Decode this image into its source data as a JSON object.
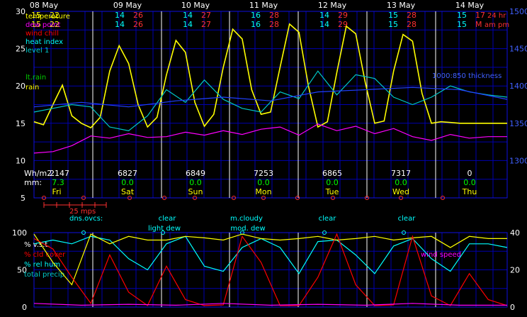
{
  "chart_data": [
    {
      "type": "line",
      "panel": "upper",
      "x_unit": "date",
      "x_ticks": [
        "08 May",
        "09 May",
        "10 May",
        "11 May",
        "12 May",
        "13 May",
        "14 May"
      ],
      "day_labels": [
        "Fri",
        "Sat",
        "Sun",
        "Mon",
        "Tue",
        "Wed",
        "Thu"
      ],
      "ylim_left": [
        5,
        30
      ],
      "yticks_left": [
        "5",
        "10",
        "15",
        "20",
        "25",
        "30"
      ],
      "ylim_right": [
        1250,
        1500
      ],
      "yticks_right": [
        "1300",
        "1350",
        "1400",
        "1450",
        "1500"
      ],
      "legend_left": [
        {
          "label": "temperature",
          "color": "#ffff00"
        },
        {
          "label": "dew point",
          "color": "#ff00ff"
        },
        {
          "label": "wind chill",
          "color": "#ff0000"
        },
        {
          "label": "heat index",
          "color": "#00ffff"
        },
        {
          "label": "level 1",
          "color": "#00c8c8"
        }
      ],
      "legend_rain": [
        {
          "label": "lt.rain",
          "color": "#00cc00"
        },
        {
          "label": "rain",
          "color": "#ffff00"
        }
      ],
      "thickness_label": "1000:850 thickness",
      "hi_lo_rows": [
        {
          "day": "08 May",
          "a_left": "15",
          "a_right": "22",
          "b_left": "15",
          "b_right": "22",
          "color": "#ffff00"
        },
        {
          "day": "09 May",
          "a_left": "14",
          "a_right": "26",
          "b_left": "14",
          "b_right": "26"
        },
        {
          "day": "10 May",
          "a_left": "14",
          "a_right": "27",
          "b_left": "14",
          "b_right": "27"
        },
        {
          "day": "11 May",
          "a_left": "16",
          "a_right": "28",
          "b_left": "16",
          "b_right": "28"
        },
        {
          "day": "12 May",
          "a_left": "14",
          "a_right": "29",
          "b_left": "14",
          "b_right": "29"
        },
        {
          "day": "13 May",
          "a_left": "15",
          "a_right": "28",
          "b_left": "15",
          "b_right": "28"
        },
        {
          "day": "14 May",
          "a_left": "15",
          "a_right": "17",
          "b_left": "15",
          "b_right": "M"
        }
      ],
      "hi_lo_suffix": {
        "top": "24 hr",
        "bottom": "am pm"
      },
      "radiation": {
        "label": "Wh/m2:",
        "values": [
          "2147",
          "6827",
          "6849",
          "7253",
          "6865",
          "7317",
          "0"
        ]
      },
      "precip": {
        "label": "mm:",
        "values": [
          "7.3",
          "0.0",
          "0.0",
          "0.0",
          "0.0",
          "0.0",
          "0.0"
        ]
      },
      "wind_scale_label": "25 mps",
      "series": [
        {
          "name": "temperature",
          "color": "#ffff00",
          "x": [
            0,
            0.02,
            0.04,
            0.06,
            0.08,
            0.1,
            0.12,
            0.14,
            0.16,
            0.18,
            0.2,
            0.22,
            0.24,
            0.26,
            0.28,
            0.3,
            0.32,
            0.34,
            0.36,
            0.38,
            0.4,
            0.42,
            0.44,
            0.46,
            0.48,
            0.5,
            0.52,
            0.54,
            0.56,
            0.58,
            0.6,
            0.62,
            0.64,
            0.66,
            0.68,
            0.7,
            0.72,
            0.74,
            0.76,
            0.78,
            0.8,
            0.82,
            0.84,
            0.86,
            0.88,
            0.9,
            0.92,
            0.94,
            0.96,
            0.98,
            1.0
          ],
          "y": [
            15.2,
            14.8,
            17.5,
            20.1,
            16.0,
            15.0,
            14.4,
            15.8,
            22.0,
            25.4,
            23.0,
            17.5,
            14.5,
            15.8,
            21.5,
            26.1,
            24.5,
            17.8,
            14.6,
            16.2,
            22.5,
            27.6,
            26.3,
            19.5,
            16.2,
            16.5,
            22.5,
            28.3,
            27.2,
            20.0,
            14.5,
            15.2,
            21.8,
            28.0,
            27.0,
            20.5,
            15.0,
            15.3,
            22.0,
            26.9,
            26.0,
            19.0,
            15.0,
            15.2,
            15.1,
            15.0,
            15.0,
            15.0,
            15.0,
            15.0,
            15.0
          ]
        },
        {
          "name": "dew point",
          "color": "#ff00ff",
          "x": [
            0,
            0.04,
            0.08,
            0.12,
            0.16,
            0.2,
            0.24,
            0.28,
            0.32,
            0.36,
            0.4,
            0.44,
            0.48,
            0.52,
            0.56,
            0.6,
            0.64,
            0.68,
            0.72,
            0.76,
            0.8,
            0.84,
            0.88,
            0.92,
            0.96,
            1.0
          ],
          "y": [
            11.0,
            11.2,
            12.0,
            13.3,
            13.0,
            13.6,
            13.1,
            13.2,
            13.8,
            13.4,
            14.0,
            13.5,
            14.2,
            14.5,
            13.4,
            14.9,
            14.0,
            14.6,
            13.6,
            14.3,
            13.2,
            12.7,
            13.5,
            13.0,
            13.2,
            13.2
          ]
        },
        {
          "name": "level 1",
          "color": "#00c8c8",
          "axis": "right",
          "x": [
            0,
            0.04,
            0.08,
            0.12,
            0.16,
            0.2,
            0.24,
            0.28,
            0.32,
            0.36,
            0.4,
            0.44,
            0.48,
            0.52,
            0.56,
            0.6,
            0.64,
            0.68,
            0.72,
            0.76,
            0.8,
            0.84,
            0.88,
            0.92,
            0.96,
            1.0
          ],
          "y": [
            1365,
            1370,
            1375,
            1372,
            1345,
            1340,
            1360,
            1395,
            1378,
            1408,
            1382,
            1370,
            1365,
            1392,
            1383,
            1420,
            1388,
            1415,
            1410,
            1385,
            1375,
            1385,
            1400,
            1392,
            1388,
            1385
          ]
        },
        {
          "name": "1000:850 thickness",
          "color": "#2040ff",
          "axis": "right",
          "x": [
            0,
            0.1,
            0.2,
            0.3,
            0.4,
            0.5,
            0.6,
            0.7,
            0.8,
            0.9,
            1.0
          ],
          "y": [
            1372,
            1378,
            1372,
            1380,
            1385,
            1380,
            1392,
            1395,
            1398,
            1395,
            1382
          ]
        }
      ]
    },
    {
      "type": "line",
      "panel": "lower",
      "ylim_left": [
        0,
        100
      ],
      "yticks_left": [
        "0",
        "50",
        "100"
      ],
      "ylim_right": [
        0,
        40
      ],
      "yticks_right": [
        "0",
        "20",
        "40"
      ],
      "legend": [
        {
          "label": "% v.s.t.",
          "color": "#ffffff"
        },
        {
          "label": "% cld cover",
          "color": "#ff0000"
        },
        {
          "label": "% rel hum",
          "color": "#00ffff"
        },
        {
          "label": "total precip",
          "color": "#00c8c8"
        }
      ],
      "wind_label": "wind speed",
      "labels_top": [
        "dns.ovcs:",
        "clear",
        "m.cloudy",
        "clear",
        "clear"
      ],
      "labels_bottom": [
        "light dew",
        "mod. dew"
      ],
      "series": [
        {
          "name": "% rel hum",
          "color": "#00ffff",
          "x": [
            0,
            0.04,
            0.08,
            0.12,
            0.16,
            0.2,
            0.24,
            0.28,
            0.32,
            0.36,
            0.4,
            0.44,
            0.48,
            0.52,
            0.56,
            0.6,
            0.64,
            0.68,
            0.72,
            0.76,
            0.8,
            0.84,
            0.88,
            0.92,
            0.96,
            1.0
          ],
          "y": [
            85,
            90,
            85,
            95,
            90,
            65,
            50,
            85,
            95,
            55,
            48,
            80,
            92,
            80,
            45,
            88,
            90,
            70,
            45,
            82,
            92,
            65,
            48,
            85,
            85,
            80
          ]
        },
        {
          "name": "% v.s.t.",
          "color": "#ffff00",
          "x": [
            0,
            0.04,
            0.08,
            0.12,
            0.16,
            0.2,
            0.24,
            0.28,
            0.32,
            0.36,
            0.4,
            0.44,
            0.48,
            0.52,
            0.56,
            0.6,
            0.64,
            0.68,
            0.72,
            0.76,
            0.8,
            0.84,
            0.88,
            0.92,
            0.96,
            1.0
          ],
          "y": [
            98,
            60,
            30,
            98,
            85,
            95,
            90,
            90,
            95,
            93,
            90,
            98,
            92,
            90,
            92,
            95,
            90,
            92,
            95,
            90,
            93,
            95,
            80,
            95,
            92,
            92
          ]
        },
        {
          "name": "% cld cover",
          "color": "#ff0000",
          "x": [
            0,
            0.04,
            0.08,
            0.12,
            0.16,
            0.2,
            0.24,
            0.28,
            0.32,
            0.36,
            0.4,
            0.44,
            0.48,
            0.52,
            0.56,
            0.6,
            0.64,
            0.68,
            0.72,
            0.76,
            0.8,
            0.84,
            0.88,
            0.92,
            0.96,
            1.0
          ],
          "y": [
            92,
            78,
            40,
            5,
            70,
            20,
            2,
            55,
            10,
            2,
            3,
            95,
            60,
            2,
            2,
            40,
            98,
            30,
            2,
            3,
            95,
            15,
            2,
            45,
            10,
            2
          ]
        },
        {
          "name": "wind speed",
          "color": "#ff00ff",
          "axis": "right",
          "x": [
            0,
            0.1,
            0.2,
            0.3,
            0.4,
            0.5,
            0.6,
            0.7,
            0.8,
            0.9,
            1.0
          ],
          "y": [
            2,
            1,
            1.5,
            1,
            2,
            1,
            1.5,
            1,
            2,
            1,
            1
          ]
        }
      ]
    }
  ]
}
